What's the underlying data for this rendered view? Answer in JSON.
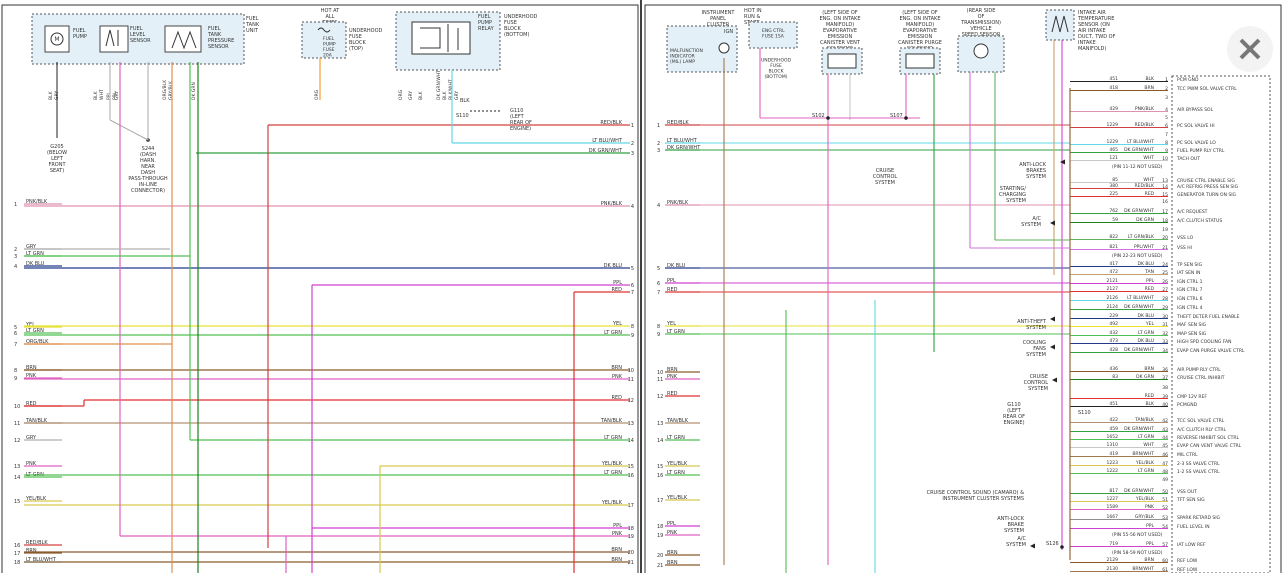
{
  "left": {
    "fuel_tank_unit": "FUEL TANK UNIT",
    "fuel_pump": "FUEL PUMP",
    "fuel_level_sensor": "FUEL LEVEL SENSOR",
    "fuel_tank_pressure_sensor": "FUEL TANK PRESSURE SENSOR",
    "hot_at_all_times": "HOT AT ALL TIMES",
    "fuel_pump_fuse": "FUEL PUMP FUSE 20A",
    "underhood_fuse_block_top": "UNDERHOOD FUSE BLOCK (TOP)",
    "fuel_pump_relay": "FUEL PUMP RELAY",
    "underhood_fuse_block_bottom": "UNDERHOOD FUSE BLOCK (BOTTOM)",
    "g110": "G110 (LEFT REAR OF ENGINE)",
    "s110": "S110",
    "g205": "G205 (BELOW LEFT FRONT SEAT)",
    "s244": "S244 (DASH HARN. NEAR DASH PASS-THROUGH IN-LINE CONNECTOR)",
    "blk": "BLK",
    "top_wire_labels": [
      "BLK",
      "GRY",
      "BLK",
      "WHT",
      "PPL",
      "ORG/BLK",
      "GRY/BLK",
      "DK GRN",
      "ORG",
      "ORG",
      "GRY",
      "BLK",
      "DK GRN/WHT",
      "BLK",
      "BLK/WHT",
      "GRY",
      "PPL",
      "GRY"
    ],
    "left_pins": [
      "1",
      "2",
      "3",
      "4",
      "5",
      "6",
      "7",
      "8",
      "9",
      "10",
      "11",
      "12",
      "13",
      "14",
      "15",
      "16",
      "17",
      "18"
    ],
    "left_wires": [
      "PNK/BLK",
      "GRY",
      "LT GRN",
      "DK BLU",
      "YEL",
      "LT GRN",
      "ORG/BLK",
      "BRN",
      "PNK",
      "RED",
      "TAN/BLK",
      "GRY",
      "PNK",
      "LT GRN",
      "YEL/BLK",
      "RED/BLK",
      "BRN",
      "LT BLU/WHT"
    ],
    "right_wires": [
      "RED/BLK",
      "LT BLU/WHT",
      "DK GRN/WHT",
      "PNK/BLK",
      "DK BLU",
      "PPL",
      "RED",
      "YEL",
      "LT GRN",
      "BRN",
      "PNK",
      "RED",
      "TAN/BLK",
      "LT GRN",
      "YEL/BLK",
      "LT GRN",
      "YEL/BLK",
      "PPL",
      "PNK",
      "BRN",
      "BRN"
    ],
    "right_pins": [
      "1",
      "2",
      "3",
      "4",
      "5",
      "6",
      "7",
      "8",
      "9",
      "10",
      "11",
      "12",
      "13",
      "14",
      "15",
      "16",
      "17",
      "18",
      "19",
      "20",
      "21"
    ]
  },
  "right": {
    "instrument_panel_cluster": "INSTRUMENT PANEL CLUSTER",
    "ign": "IGN",
    "mil": "MALFUNCTION INDICATOR (MIL) LAMP",
    "hot_in_run_start": "HOT IN RUN & START",
    "eng_ctrl_fuse": "ENG CTRL FUSE 15A",
    "underhood_fuse_block_bottom": "UNDERHOOD FUSE BLOCK (BOTTOM)",
    "evap_vent": "(LEFT SIDE OF ENG. ON INTAKE MANIFOLD) EVAPORATIVE EMISSION CANISTER VENT SOLENOID",
    "evap_purge": "(LEFT SIDE OF ENG. ON INTAKE MANIFOLD) EVAPORATIVE EMISSION CANISTER PURGE SOLENOID",
    "vss": "(REAR SIDE OF TRANSMISSION) VEHICLE SPEED SENSOR",
    "iat": "INTAKE AIR TEMPERATURE SENSOR (ON AIR INTAKE DUCT, TWD OF INTAKE MANIFOLD)",
    "s102": "S102",
    "s107": "S107",
    "s110": "S110",
    "s126": "S126",
    "g110": "G110 (LEFT REAR OF ENGINE)",
    "anti_lock": "ANTI-LOCK BRAKES SYSTEM",
    "cruise_control": "CRUISE CONTROL SYSTEM",
    "starting": "STARTING/ CHARGING SYSTEM",
    "ac_system": "A/C SYSTEM",
    "anti_theft": "ANTI-THEFT SYSTEM",
    "cooling_fans": "COOLING FANS SYSTEM",
    "cruise_control2": "CRUISE CONTROL SYSTEM",
    "cruise_sound": "CRUISE CONTROL SOUND (CAMARO) & INSTRUMENT CLUSTER SYSTEMS",
    "anti_lock2": "ANTI-LOCK BRAKE SYSTEM",
    "ac_system2": "A/C SYSTEM",
    "left_pins": [
      "1",
      "2",
      "3",
      "4",
      "5",
      "6",
      "7",
      "8",
      "9",
      "10",
      "11",
      "12",
      "13",
      "14",
      "15",
      "16",
      "17",
      "18",
      "19",
      "20",
      "21"
    ],
    "left_wires": [
      "RED/BLK",
      "LT BLU/WHT",
      "DK GRN/WHT",
      "PNK/BLK",
      "DK BLU",
      "PPL",
      "RED",
      "YEL",
      "LT GRN",
      "BRN",
      "PNK",
      "RED",
      "TAN/BLK",
      "LT GRN",
      "YEL/BLK",
      "LT GRN",
      "YEL/BLK",
      "PPL",
      "PNK",
      "BRN",
      "BRN"
    ],
    "table": [
      {
        "circuit": "451",
        "color": "BLK",
        "pin": "1",
        "fn": "PCM GND"
      },
      {
        "circuit": "418",
        "color": "BRN",
        "pin": "2",
        "fn": "TCC PWM SOL VALVE CTRL"
      },
      {
        "circuit": "",
        "color": "",
        "pin": "3",
        "fn": ""
      },
      {
        "circuit": "429",
        "color": "PNK/BLK",
        "pin": "4",
        "fn": "AIR BYPASS SOL"
      },
      {
        "circuit": "",
        "color": "",
        "pin": "5",
        "fn": ""
      },
      {
        "circuit": "1229",
        "color": "RED/BLK",
        "pin": "6",
        "fn": "PC SOL VALVE HI"
      },
      {
        "circuit": "",
        "color": "",
        "pin": "7",
        "fn": ""
      },
      {
        "circuit": "1229",
        "color": "LT BLU/WHT",
        "pin": "8",
        "fn": "PC SOL VALVE LO"
      },
      {
        "circuit": "465",
        "color": "DK GRN/WHT",
        "pin": "9",
        "fn": "FUEL PUMP RLY CTRL"
      },
      {
        "circuit": "121",
        "color": "WHT",
        "pin": "10",
        "fn": "TACH OUT"
      },
      {
        "circuit": "(PIN 11-12 NOT USED)",
        "color": "",
        "pin": "",
        "fn": ""
      },
      {
        "circuit": "85",
        "color": "WHT",
        "pin": "13",
        "fn": "CRUISE CTRL ENABLE SIG"
      },
      {
        "circuit": "380",
        "color": "RED/BLK",
        "pin": "14",
        "fn": "A/C REFRIG PRESS SEN SIG"
      },
      {
        "circuit": "225",
        "color": "RED",
        "pin": "15",
        "fn": "GENERATOR TURN ON SIG"
      },
      {
        "circuit": "",
        "color": "",
        "pin": "16",
        "fn": ""
      },
      {
        "circuit": "762",
        "color": "DK GRN/WHT",
        "pin": "17",
        "fn": "A/C REQUEST"
      },
      {
        "circuit": "59",
        "color": "DK GRN",
        "pin": "18",
        "fn": "A/C CLUTCH STATUS"
      },
      {
        "circuit": "",
        "color": "",
        "pin": "19",
        "fn": ""
      },
      {
        "circuit": "822",
        "color": "LT GRN/BLK",
        "pin": "20",
        "fn": "VSS LO"
      },
      {
        "circuit": "821",
        "color": "PPL/WHT",
        "pin": "21",
        "fn": "VSS HI"
      },
      {
        "circuit": "(PIN 22-23 NOT USED)",
        "color": "",
        "pin": "",
        "fn": ""
      },
      {
        "circuit": "417",
        "color": "DK BLU",
        "pin": "24",
        "fn": "TP SEN SIG"
      },
      {
        "circuit": "472",
        "color": "TAN",
        "pin": "25",
        "fn": "IAT SEN IN"
      },
      {
        "circuit": "2121",
        "color": "PPL",
        "pin": "26",
        "fn": "IGN CTRL 1"
      },
      {
        "circuit": "2127",
        "color": "RED",
        "pin": "27",
        "fn": "IGN CTRL 7"
      },
      {
        "circuit": "2126",
        "color": "LT BLU/WHT",
        "pin": "28",
        "fn": "IGN CTRL 6"
      },
      {
        "circuit": "2124",
        "color": "DK GRN/WHT",
        "pin": "29",
        "fn": "IGN CTRL 4"
      },
      {
        "circuit": "229",
        "color": "DK BLU",
        "pin": "30",
        "fn": "THEFT DETER FUEL ENABLE"
      },
      {
        "circuit": "492",
        "color": "YEL",
        "pin": "31",
        "fn": "MAF SEN SIG"
      },
      {
        "circuit": "432",
        "color": "LT GRN",
        "pin": "32",
        "fn": "MAP SEN SIG"
      },
      {
        "circuit": "473",
        "color": "DK BLU",
        "pin": "33",
        "fn": "HIGH SPD COOLING FAN"
      },
      {
        "circuit": "428",
        "color": "DK GRN/WHT",
        "pin": "34",
        "fn": "EVAP CAN PURGE VALVE CTRL"
      },
      {
        "circuit": "436",
        "color": "BRN",
        "pin": "36",
        "fn": "AIR PUMP RLY CTRL"
      },
      {
        "circuit": "83",
        "color": "DK GRN",
        "pin": "37",
        "fn": "CRUISE CTRL INHIBIT"
      },
      {
        "circuit": "",
        "color": "",
        "pin": "38",
        "fn": ""
      },
      {
        "circuit": "",
        "color": "RED",
        "pin": "39",
        "fn": "CMP 12V REF"
      },
      {
        "circuit": "451",
        "color": "BLK",
        "pin": "40",
        "fn": "PCMGND"
      },
      {
        "circuit": "422",
        "color": "TAN/BLK",
        "pin": "42",
        "fn": "TCC SOL VALVE CTRL"
      },
      {
        "circuit": "459",
        "color": "DK GRN/WHT",
        "pin": "43",
        "fn": "A/C CLUTCH RLY CTRL"
      },
      {
        "circuit": "1652",
        "color": "LT GRN",
        "pin": "44",
        "fn": "REVERSE INHIBIT SOL CTRL"
      },
      {
        "circuit": "1310",
        "color": "WHT",
        "pin": "45",
        "fn": "EVAP CAN VENT VALVE CTRL"
      },
      {
        "circuit": "419",
        "color": "BRN/WHT",
        "pin": "46",
        "fn": "MIL CTRL"
      },
      {
        "circuit": "1223",
        "color": "YEL/BLK",
        "pin": "47",
        "fn": "2-3 SS VALVE CTRL"
      },
      {
        "circuit": "1222",
        "color": "LT GRN",
        "pin": "48",
        "fn": "1-2 SS VALVE CTRL"
      },
      {
        "circuit": "",
        "color": "",
        "pin": "49",
        "fn": ""
      },
      {
        "circuit": "817",
        "color": "DK GRN/WHT",
        "pin": "50",
        "fn": "VSS OUT"
      },
      {
        "circuit": "1227",
        "color": "YEL/BLK",
        "pin": "51",
        "fn": "TFT SEN SIG"
      },
      {
        "circuit": "1589",
        "color": "PNK",
        "pin": "52",
        "fn": ""
      },
      {
        "circuit": "1667",
        "color": "GRY/BLK",
        "pin": "53",
        "fn": "SPARK RETARD SIG"
      },
      {
        "circuit": "",
        "color": "PPL",
        "pin": "54",
        "fn": "FUEL LEVEL IN"
      },
      {
        "circuit": "(PIN 55-56 NOT USED)",
        "color": "",
        "pin": "",
        "fn": ""
      },
      {
        "circuit": "719",
        "color": "PPL",
        "pin": "57",
        "fn": "IAT LOW REF"
      },
      {
        "circuit": "(PIN 58-59 NOT USED)",
        "color": "",
        "pin": "",
        "fn": ""
      },
      {
        "circuit": "2129",
        "color": "BRN",
        "pin": "60",
        "fn": "REF LOW"
      },
      {
        "circuit": "2130",
        "color": "BRN/WHT",
        "pin": "61",
        "fn": "REF LOW"
      }
    ]
  },
  "icons": {
    "close": "close-icon"
  },
  "colors": {
    "frame": "#333333",
    "component": "#e3f0f8",
    "divider": "#000000",
    "close_bg": "#f3f3f3",
    "close_x": "#777777"
  }
}
